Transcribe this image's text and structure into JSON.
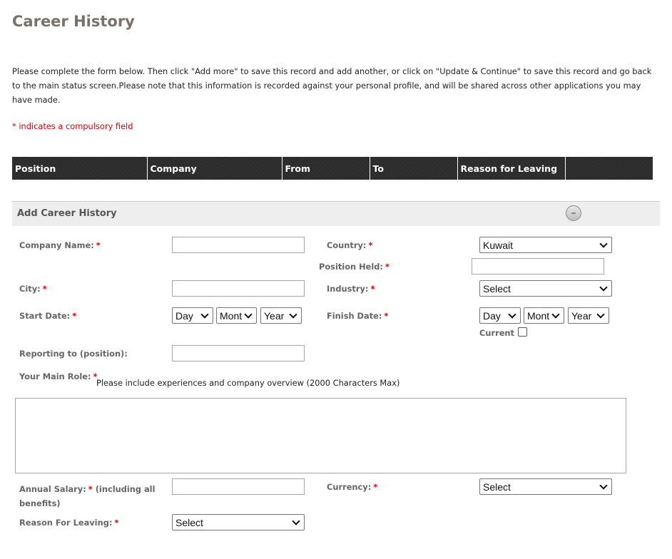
{
  "page": {
    "title": "Career History",
    "intro": "Please complete the form below. Then click \"Add more\" to save this record and add another, or click on \"Update & Continue\" to save this record and go back to the main status screen.Please note that this information is recorded against your personal profile, and will be shared across other applications you may have made.",
    "required_note": "* indicates a compulsory field"
  },
  "history_table": {
    "headers": [
      "Position",
      "Company",
      "From",
      "To",
      "Reason for Leaving",
      ""
    ]
  },
  "section": {
    "title": "Add Career History",
    "collapse_icon": "minus-circle-icon",
    "collapse_symbol": "–"
  },
  "form": {
    "required_marker": "*",
    "company_name": {
      "label": "Company Name:",
      "value": ""
    },
    "country": {
      "label": "Country:",
      "value": "Kuwait"
    },
    "position_held": {
      "label": "Position Held:",
      "value": ""
    },
    "city": {
      "label": "City:",
      "value": ""
    },
    "industry": {
      "label": "Industry:",
      "value": "Select"
    },
    "start_date": {
      "label": "Start Date:",
      "day": "Day",
      "month": "Montl",
      "year": "Year"
    },
    "finish_date": {
      "label": "Finish Date:",
      "day": "Day",
      "month": "Montl",
      "year": "Year"
    },
    "current": {
      "label": "Current",
      "checked": false
    },
    "reporting_to": {
      "label": "Reporting to (position):",
      "value": ""
    },
    "main_role": {
      "label": "Your Main Role:",
      "hint": "Please include experiences and company overview  (2000 Characters Max)",
      "value": ""
    },
    "annual_salary": {
      "label": "Annual Salary:",
      "label_suffix": "(including all",
      "label_line2": "benefits)",
      "value": ""
    },
    "currency": {
      "label": "Currency:",
      "value": "Select"
    },
    "reason_for_leaving": {
      "label": "Reason For Leaving:",
      "value": "Select"
    }
  }
}
